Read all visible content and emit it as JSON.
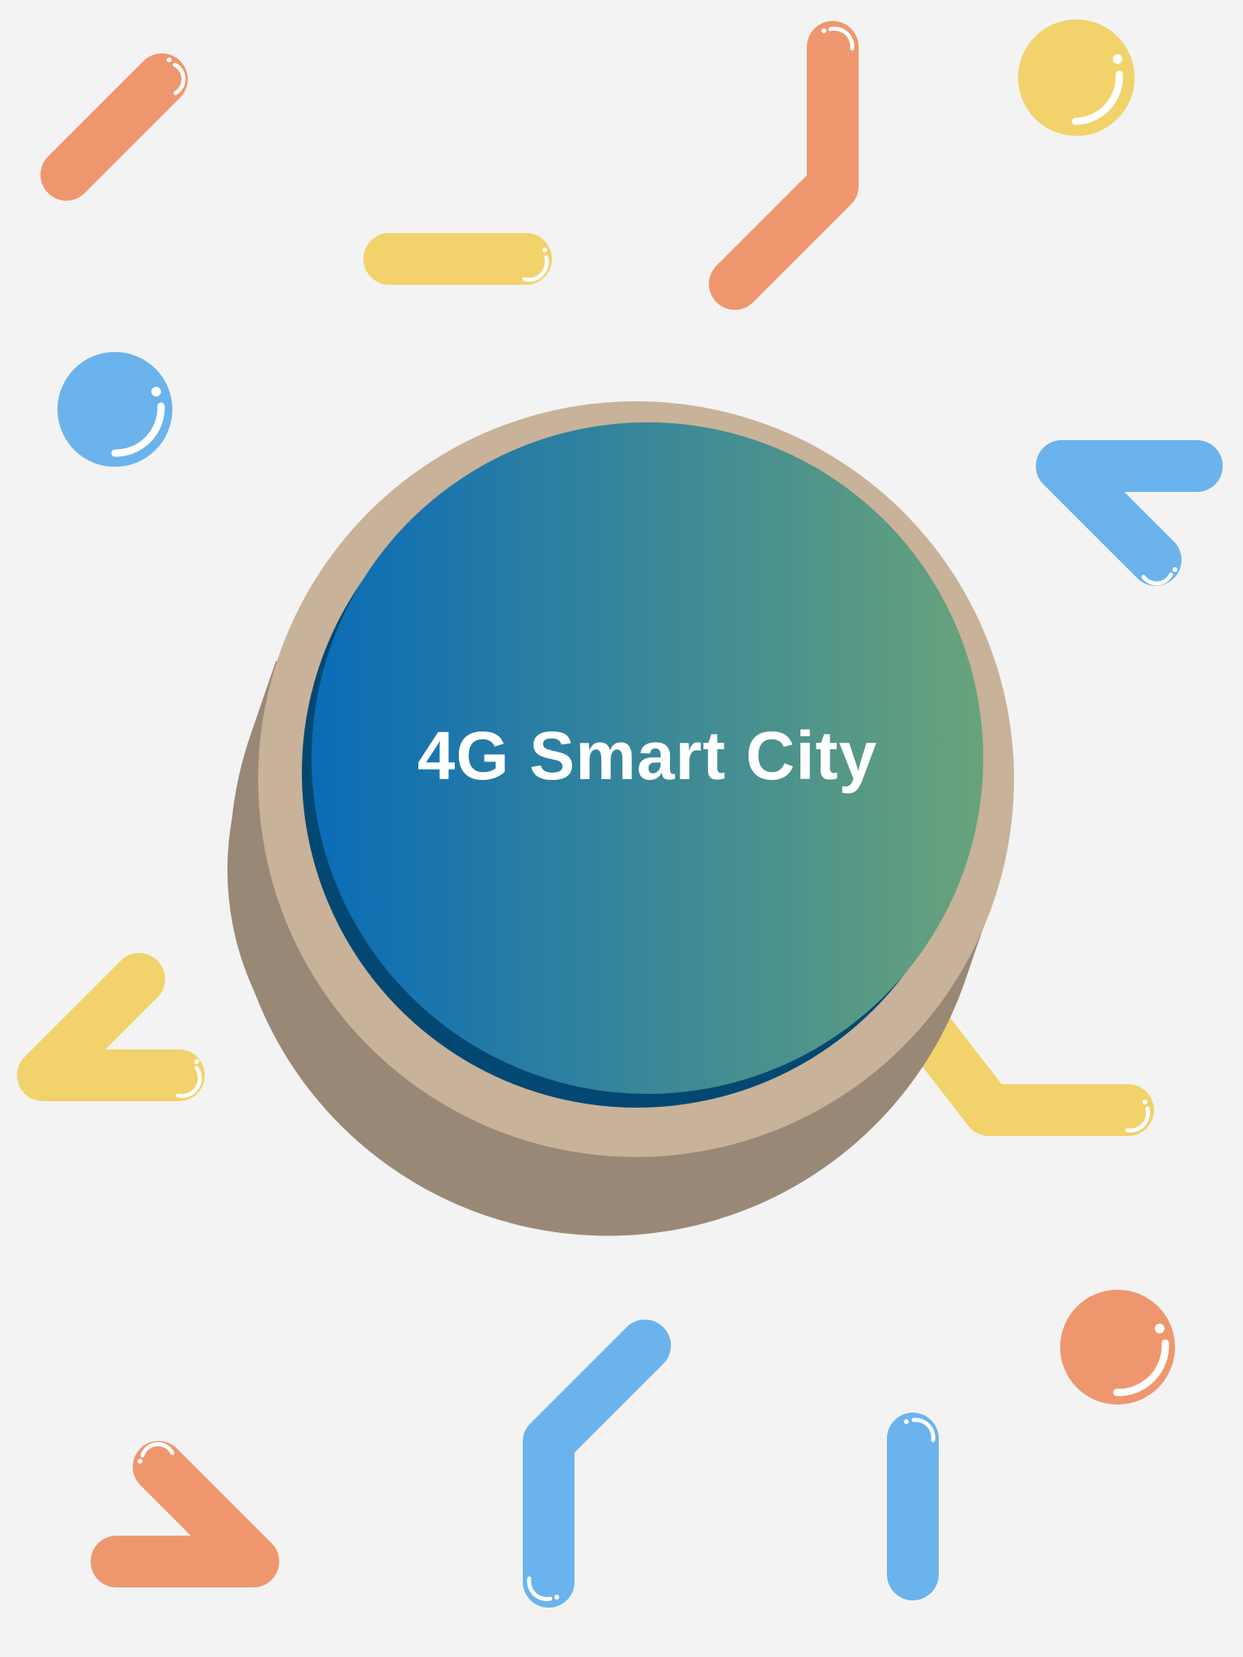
{
  "badge": {
    "title": "4G Smart City",
    "gradient_start": "#0a6bb7",
    "gradient_end": "#68a37a",
    "rim_color": "#c8b299",
    "shadow_color": "#9a8876",
    "inner_edge_color": "#034872"
  },
  "decorations": {
    "colors": {
      "orange": "#ee976f",
      "yellow": "#f1d26b",
      "blue": "#6bb3ec",
      "highlight": "#ffffff"
    },
    "shapes": [
      "orange-diagonal-bar",
      "yellow-horizontal-bar",
      "orange-bent-bar",
      "yellow-ball",
      "blue-ball",
      "blue-bent-bar",
      "yellow-arrow-left",
      "yellow-bent-bar-right",
      "orange-ball",
      "orange-arrow-right",
      "blue-bent-bar-bottom",
      "blue-vertical-bar"
    ]
  }
}
